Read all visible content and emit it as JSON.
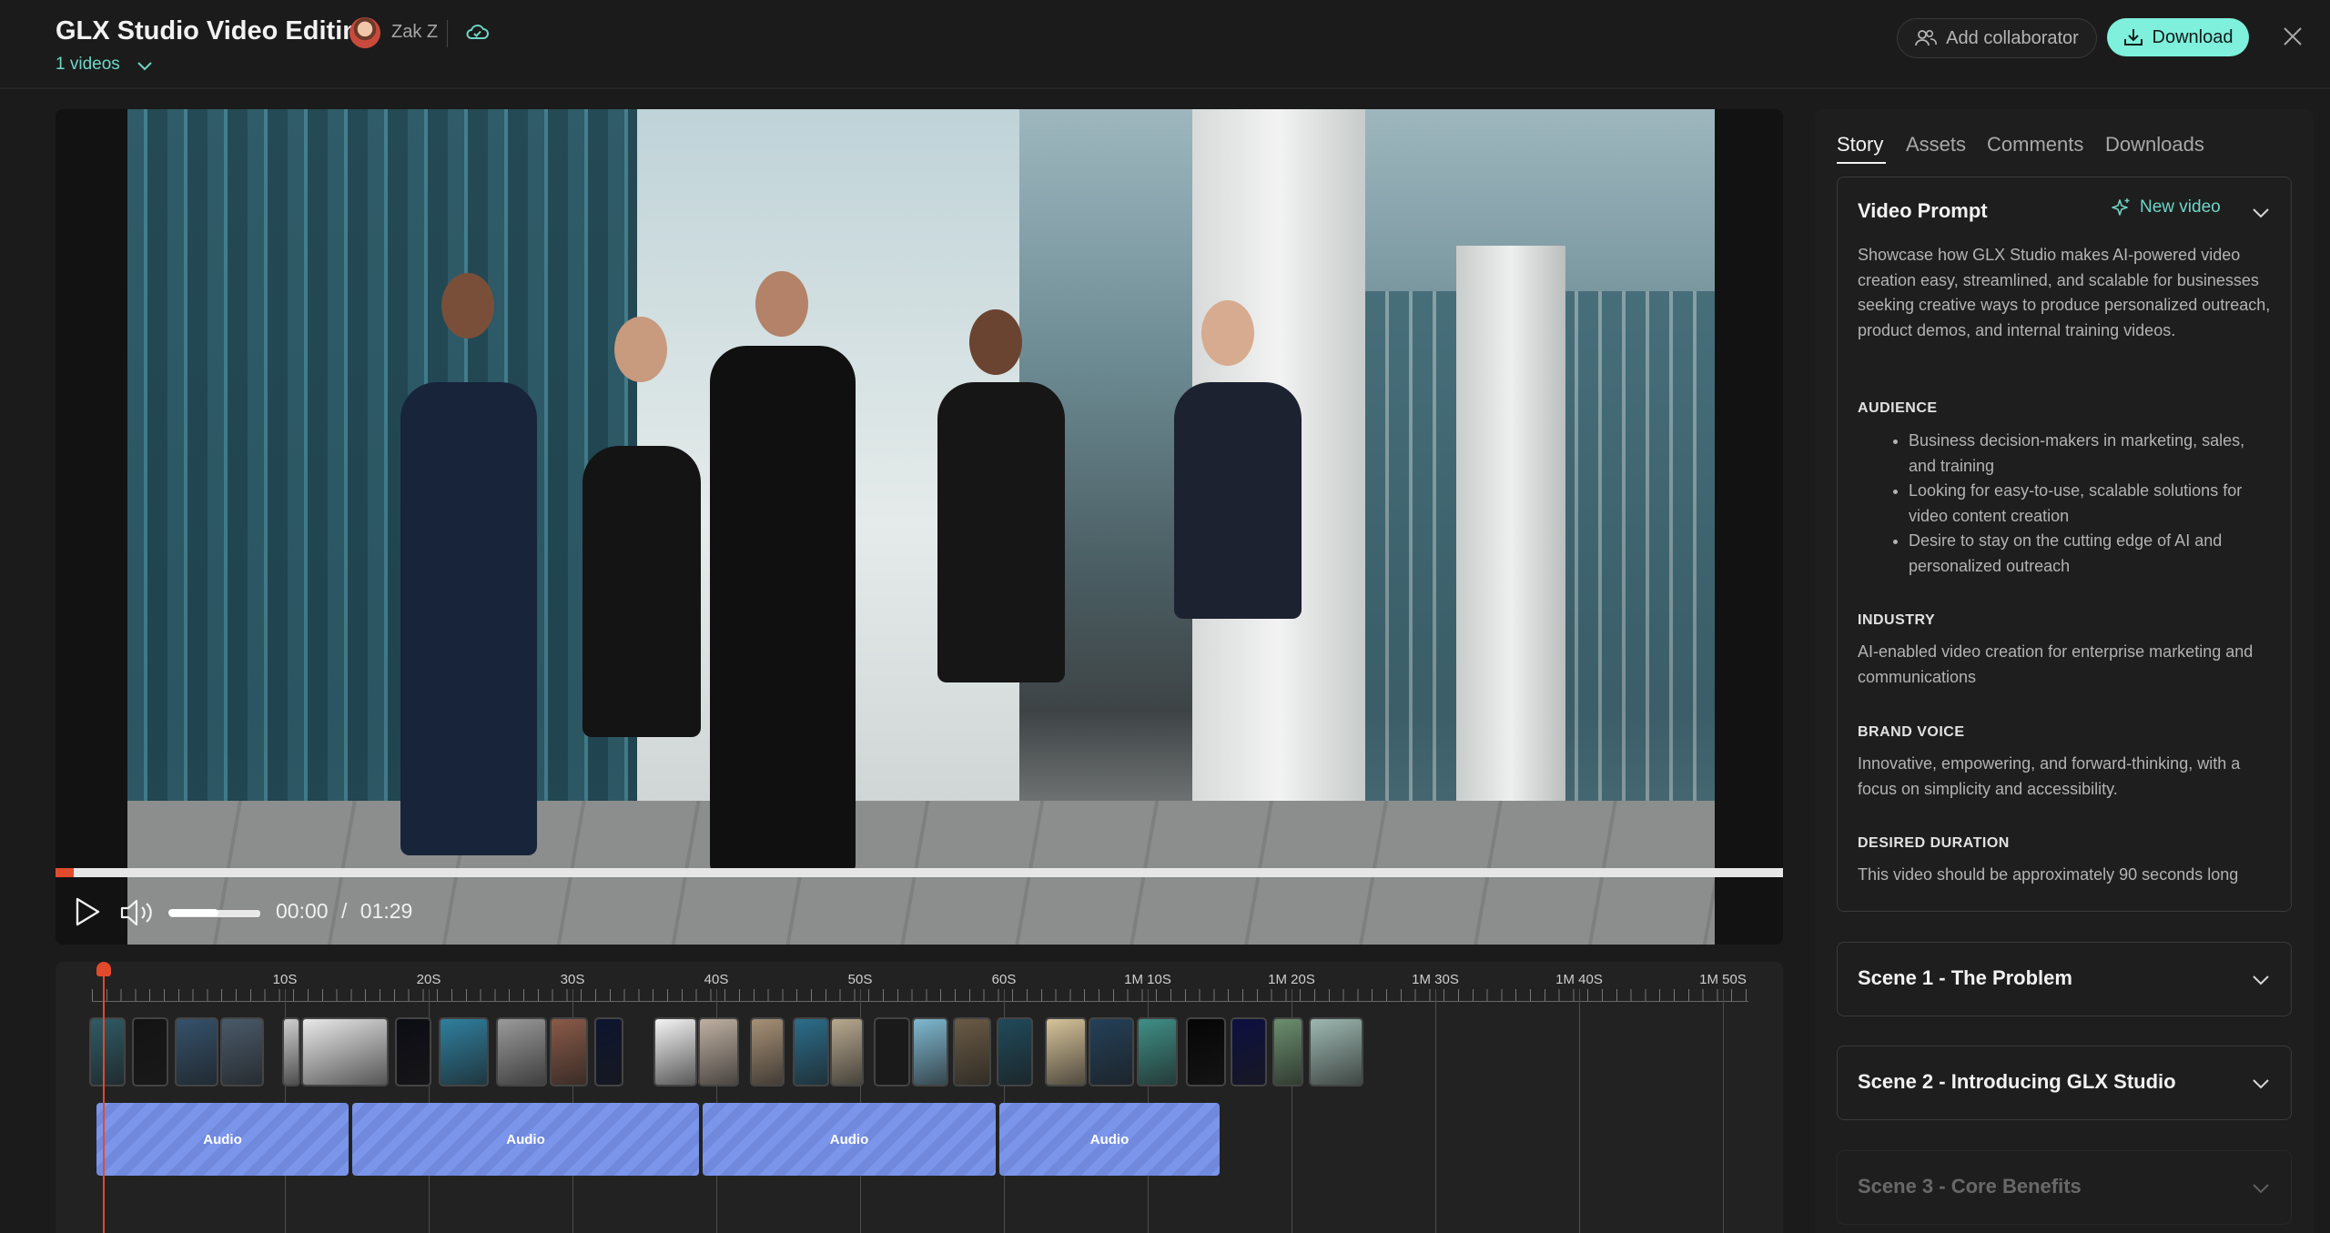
{
  "header": {
    "title": "GLX Studio Video Editing",
    "user_name": "Zak Z",
    "videos_count": "1 videos",
    "collaborator_label": "Add collaborator",
    "download_label": "Download"
  },
  "player": {
    "current_time": "00:00",
    "separator": "/",
    "duration": "01:29",
    "progress": 0.01,
    "volume": 0.55
  },
  "timeline": {
    "ticks": [
      "10S",
      "20S",
      "30S",
      "40S",
      "50S",
      "60S",
      "1M 10S",
      "1M 20S",
      "1M 30S",
      "1M 40S",
      "1M 50S"
    ],
    "audio_label": "Audio",
    "audio_tracks": [
      "Audio",
      "Audio",
      "Audio",
      "Audio"
    ],
    "clip_count": 27
  },
  "panel": {
    "tabs": [
      "Story",
      "Assets",
      "Comments",
      "Downloads"
    ],
    "active_tab": "Story",
    "prompt": {
      "title": "Video Prompt",
      "new_video_label": "New video",
      "description": "Showcase how GLX Studio makes AI-powered video creation easy, streamlined, and scalable for businesses seeking creative ways to produce personalized outreach, product demos, and internal training videos.",
      "audience_heading": "AUDIENCE",
      "audience": [
        "Business decision-makers in marketing, sales, and training",
        "Looking for easy-to-use, scalable solutions for video content creation",
        "Desire to stay on the cutting edge of AI and personalized outreach"
      ],
      "industry_heading": "INDUSTRY",
      "industry": "AI-enabled video creation for enterprise marketing and communications",
      "brand_voice_heading": "BRAND VOICE",
      "brand_voice": "Innovative, empowering, and forward-thinking, with a focus on simplicity and accessibility.",
      "duration_heading": "DESIRED DURATION",
      "duration": "This video should be approximately 90 seconds long"
    },
    "scenes": [
      "Scene 1 - The Problem",
      "Scene 2 - Introducing GLX Studio",
      "Scene 3 - Core Benefits"
    ]
  },
  "colors": {
    "accent": "#7ef0dc",
    "accent_text": "#6fd6c6",
    "playhead": "#e24a2c",
    "audio": "#7b95ea",
    "background": "#1b1b1b"
  }
}
